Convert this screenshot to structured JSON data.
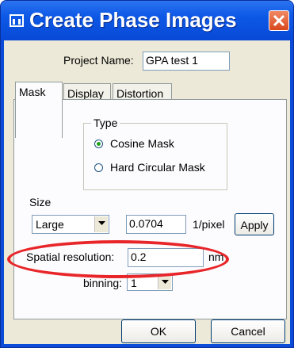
{
  "window": {
    "title": "Create Phase Images"
  },
  "icons": {
    "app": "app-icon",
    "close": "close-icon",
    "dropdown": "chevron-down-icon"
  },
  "colors": {
    "titlebar": "#0749d6",
    "close": "#d9471c",
    "annotation": "#e8262a",
    "radio_dot": "#21a121"
  },
  "project": {
    "label": "Project Name:",
    "value": "GPA test 1"
  },
  "tabs": [
    {
      "label": "Mask",
      "active": true
    },
    {
      "label": "Display",
      "active": false
    },
    {
      "label": "Distortion",
      "active": false
    }
  ],
  "type_group": {
    "title": "Type",
    "options": [
      {
        "label": "Cosine Mask",
        "selected": true
      },
      {
        "label": "Hard Circular Mask",
        "selected": false
      }
    ]
  },
  "size": {
    "label": "Size",
    "selected": "Large",
    "value": "0.0704",
    "unit": "1/pixel",
    "apply_label": "Apply"
  },
  "spatial_resolution": {
    "label": "Spatial resolution:",
    "value": "0.2",
    "unit": "nm"
  },
  "binning": {
    "label": "binning:",
    "selected": "1"
  },
  "footer": {
    "ok_label": "OK",
    "cancel_label": "Cancel"
  }
}
